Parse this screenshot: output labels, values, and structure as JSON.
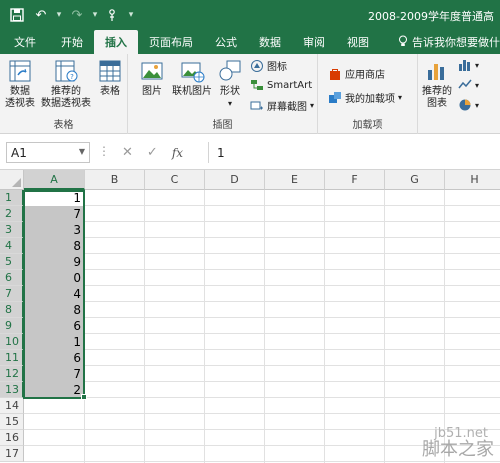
{
  "window": {
    "title": "2008-2009学年度普通高"
  },
  "tabs": [
    {
      "label": "文件"
    },
    {
      "label": "开始"
    },
    {
      "label": "插入"
    },
    {
      "label": "页面布局"
    },
    {
      "label": "公式"
    },
    {
      "label": "数据"
    },
    {
      "label": "审阅"
    },
    {
      "label": "视图"
    },
    {
      "label": "告诉我你想要做什么"
    }
  ],
  "ribbon": {
    "tables": {
      "label": "表格",
      "pivot_table": "数据\n透视表",
      "recommended_pivot": "推荐的\n数据透视表",
      "table": "表格"
    },
    "illustrations": {
      "label": "插图",
      "picture": "图片",
      "online_picture": "联机图片",
      "shapes": "形状",
      "icons": "图标",
      "smartart": "SmartArt",
      "screenshot": "屏幕截图"
    },
    "addins": {
      "label": "加载项",
      "store": "应用商店",
      "my_addins": "我的加载项"
    },
    "charts": {
      "recommended_charts": "推荐的\n图表"
    }
  },
  "formula_bar": {
    "name_box": "A1",
    "cancel": "✕",
    "enter": "✓",
    "fx": "fx",
    "content": "1"
  },
  "sheet": {
    "columns": [
      "A",
      "B",
      "C",
      "D",
      "E",
      "F",
      "G",
      "H"
    ],
    "rows": [
      "1",
      "2",
      "3",
      "4",
      "5",
      "6",
      "7",
      "8",
      "9",
      "10",
      "11",
      "12",
      "13",
      "14",
      "15",
      "16",
      "17"
    ],
    "column_a_values": [
      "1",
      "7",
      "3",
      "8",
      "9",
      "0",
      "4",
      "8",
      "6",
      "1",
      "6",
      "7",
      "2"
    ]
  },
  "watermark": {
    "site": "jb51.net",
    "brand": "脚本之家"
  },
  "colors": {
    "excel_green": "#217346",
    "selection_fill": "#c6c6c6"
  }
}
